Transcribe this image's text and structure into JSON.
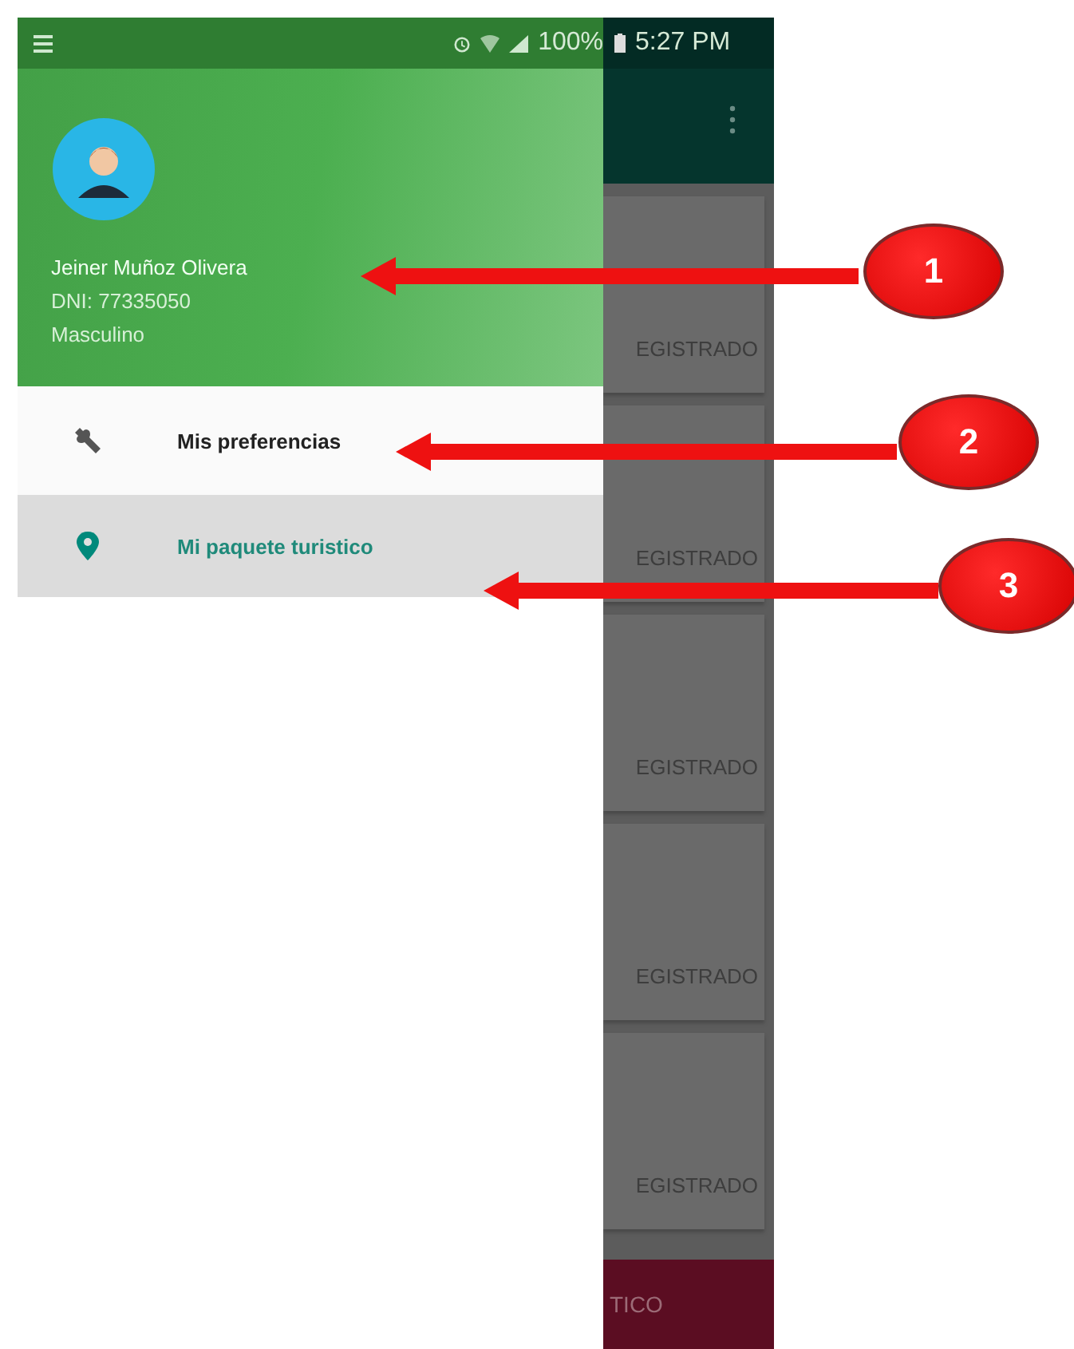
{
  "status_bar": {
    "battery": "100%",
    "time": "5:27 PM"
  },
  "profile": {
    "name": "Jeiner Muñoz Olivera",
    "dni": "DNI: 77335050",
    "gender": "Masculino"
  },
  "menu": [
    {
      "label": "Mis preferencias",
      "kind": "wrench",
      "selected": false
    },
    {
      "label": "Mi paquete turistico",
      "kind": "pin",
      "selected": true
    }
  ],
  "background_cards": [
    "EGISTRADO",
    "EGISTRADO",
    "EGISTRADO",
    "EGISTRADO",
    "EGISTRADO"
  ],
  "background_bottom_bar": "TICO",
  "annotations": [
    "1",
    "2",
    "3"
  ]
}
